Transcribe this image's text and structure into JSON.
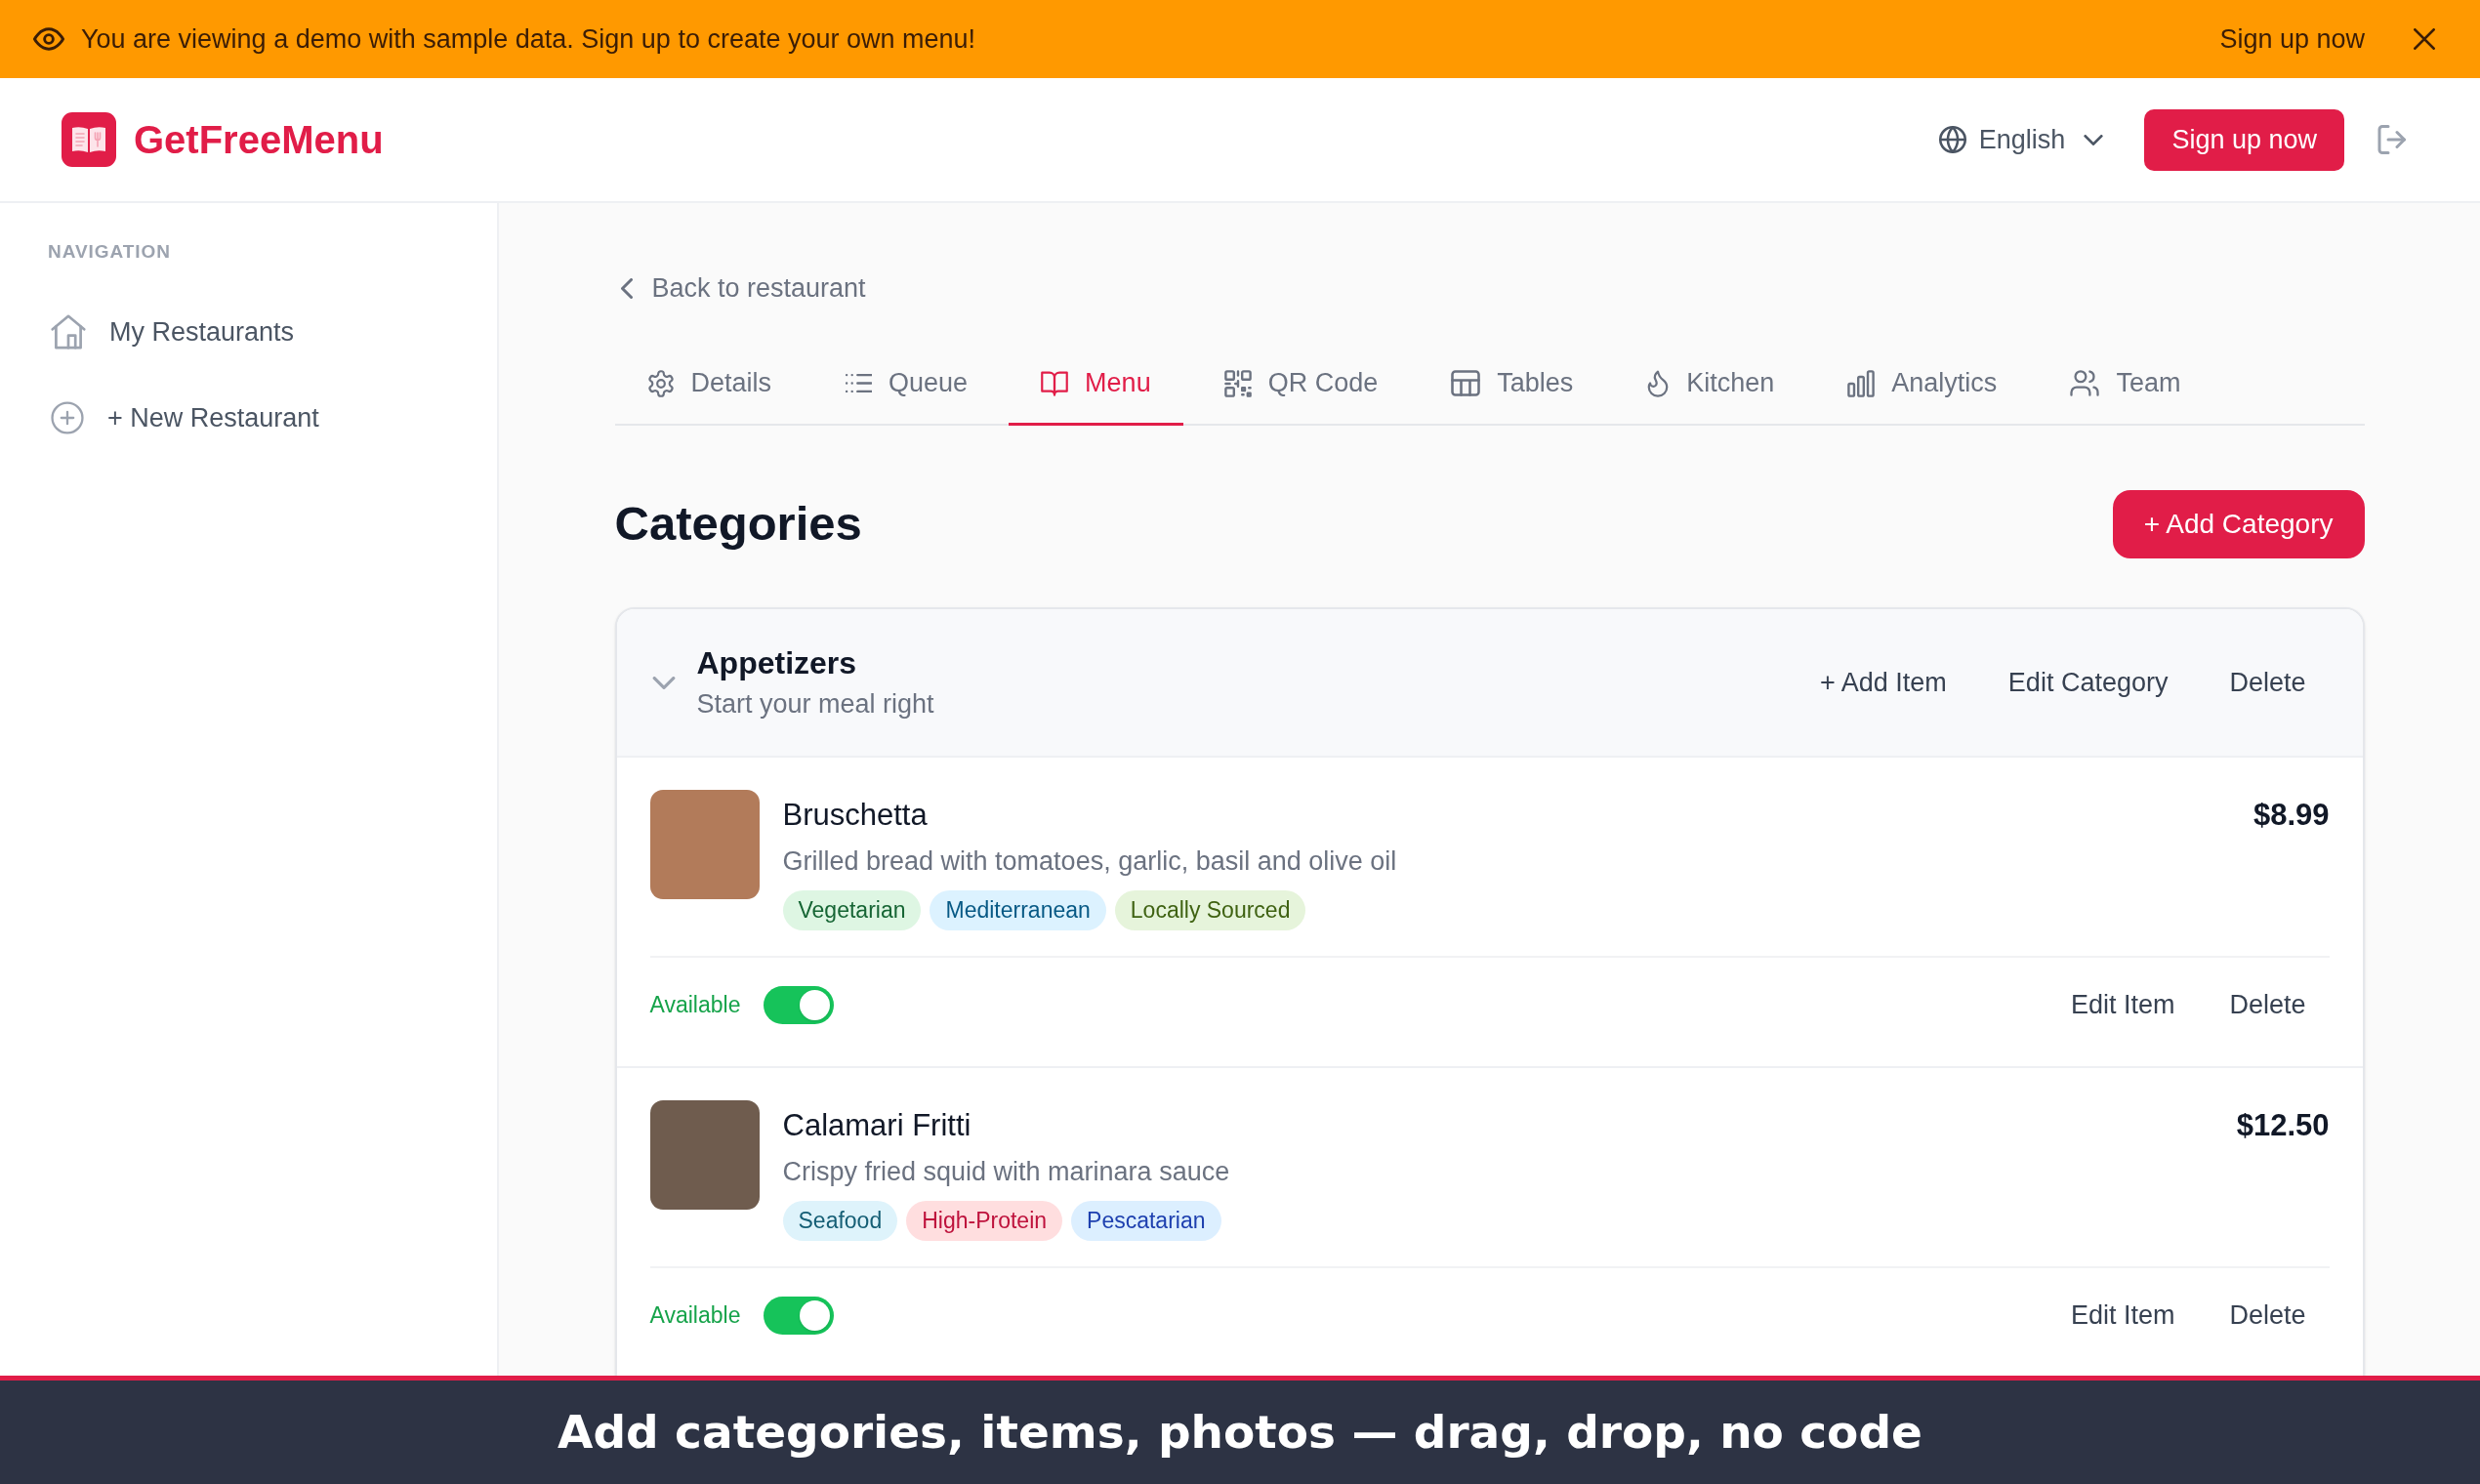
{
  "banner": {
    "message": "You are viewing a demo with sample data. Sign up to create your own menu!",
    "link": "Sign up now"
  },
  "header": {
    "brand": "GetFreeMenu",
    "language": "English",
    "signup_button": "Sign up now"
  },
  "sidebar": {
    "heading": "NAVIGATION",
    "items": [
      {
        "label": "My Restaurants",
        "selected": false
      },
      {
        "label": "+ New Restaurant",
        "selected": false
      }
    ]
  },
  "back_link": "Back to restaurant",
  "tabs": [
    {
      "label": "Details",
      "selected": false
    },
    {
      "label": "Queue",
      "selected": false
    },
    {
      "label": "Menu",
      "selected": true
    },
    {
      "label": "QR Code",
      "selected": false
    },
    {
      "label": "Tables",
      "selected": false
    },
    {
      "label": "Kitchen",
      "selected": false
    },
    {
      "label": "Analytics",
      "selected": false
    },
    {
      "label": "Team",
      "selected": false
    }
  ],
  "page_title": "Categories",
  "add_category_button": "+ Add Category",
  "categories": [
    {
      "name": "Appetizers",
      "description": "Start your meal right",
      "expanded": true,
      "actions": [
        "+ Add Item",
        "Edit Category",
        "Delete"
      ],
      "items": [
        {
          "name": "Bruschetta",
          "description": "Grilled bread with tomatoes, garlic, basil and olive oil",
          "price": "$8.99",
          "tags": [
            {
              "label": "Vegetarian",
              "color": "#166534"
            },
            {
              "label": "Mediterranean",
              "color": "#075985"
            },
            {
              "label": "Locally Sourced",
              "color": "#3f6212"
            }
          ],
          "status": "Available",
          "available": true,
          "actions": [
            "Edit Item",
            "Delete"
          ]
        },
        {
          "name": "Calamari Fritti",
          "description": "Crispy fried squid with marinara sauce",
          "price": "$12.50",
          "tags": [
            {
              "label": "Seafood",
              "color": "#155e75"
            },
            {
              "label": "High-Protein",
              "color": "#be123c"
            },
            {
              "label": "Pescatarian",
              "color": "#1e40af"
            }
          ],
          "status": "Available",
          "available": true,
          "actions": [
            "Edit Item",
            "Delete"
          ]
        }
      ]
    }
  ],
  "caption": "Add categories, items, photos — drag, drop, no code"
}
